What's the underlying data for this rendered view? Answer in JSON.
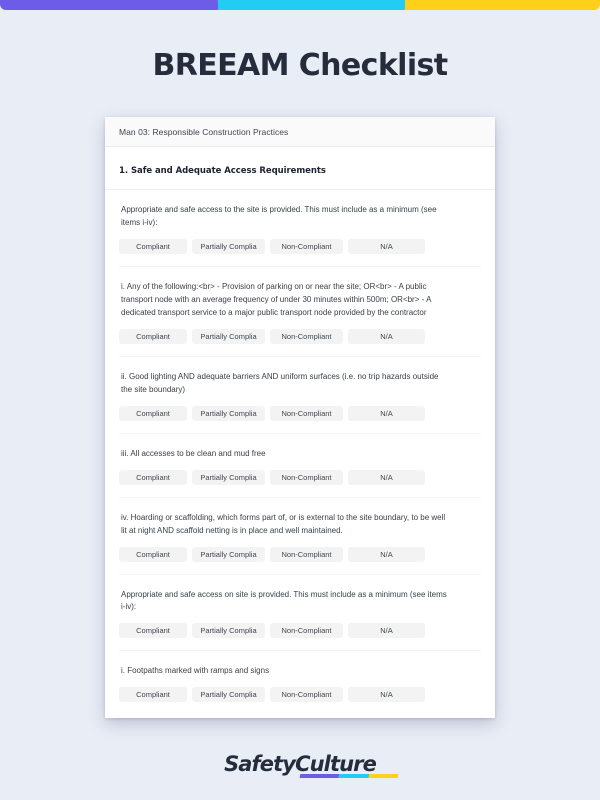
{
  "brand": {
    "purple": "#6c5ce7",
    "cyan": "#22ccf4",
    "yellow": "#ffd01a",
    "title_color": "#252c3b"
  },
  "topbar": {
    "segments": [
      {
        "name": "purple",
        "color": "#6c5ce7"
      },
      {
        "name": "cyan",
        "color": "#22ccf4"
      },
      {
        "name": "yellow",
        "color": "#ffd01a"
      }
    ]
  },
  "page": {
    "title": "BREEAM Checklist"
  },
  "document": {
    "header_label": "Man 03: Responsible Construction Practices",
    "section_title": "1. Safe and Adequate Access Requirements",
    "options": [
      "Compliant",
      "Partially Complia",
      "Non-Compliant",
      "N/A"
    ],
    "questions": [
      {
        "text": "Appropriate and safe access to the site is provided. This must include as a minimum (see items i-iv):"
      },
      {
        "text": "i. Any of the following:<br> - Provision of parking on or near the site; OR<br> - A public transport node with an average frequency of under 30 minutes within 500m; OR<br> - A dedicated transport service to a major public transport node provided by the contractor"
      },
      {
        "text": "ii. Good lighting AND adequate barriers AND uniform surfaces (i.e. no trip hazards outside the site boundary)"
      },
      {
        "text": "iii. All accesses to be clean and mud free"
      },
      {
        "text": "iv. Hoarding or scaffolding, which forms part of, or is external to the site boundary, to be well lit at night AND scaffold netting is in place and well maintained."
      },
      {
        "text": "Appropriate and safe access on site is provided. This must include as a minimum (see items i-iv):"
      },
      {
        "text": "i. Footpaths marked with ramps and signs"
      }
    ]
  },
  "footer": {
    "logo_part1": "Safety",
    "logo_part2": "Culture",
    "underline_colors": [
      "#6c5ce7",
      "#22ccf4",
      "#ffd01a"
    ]
  }
}
